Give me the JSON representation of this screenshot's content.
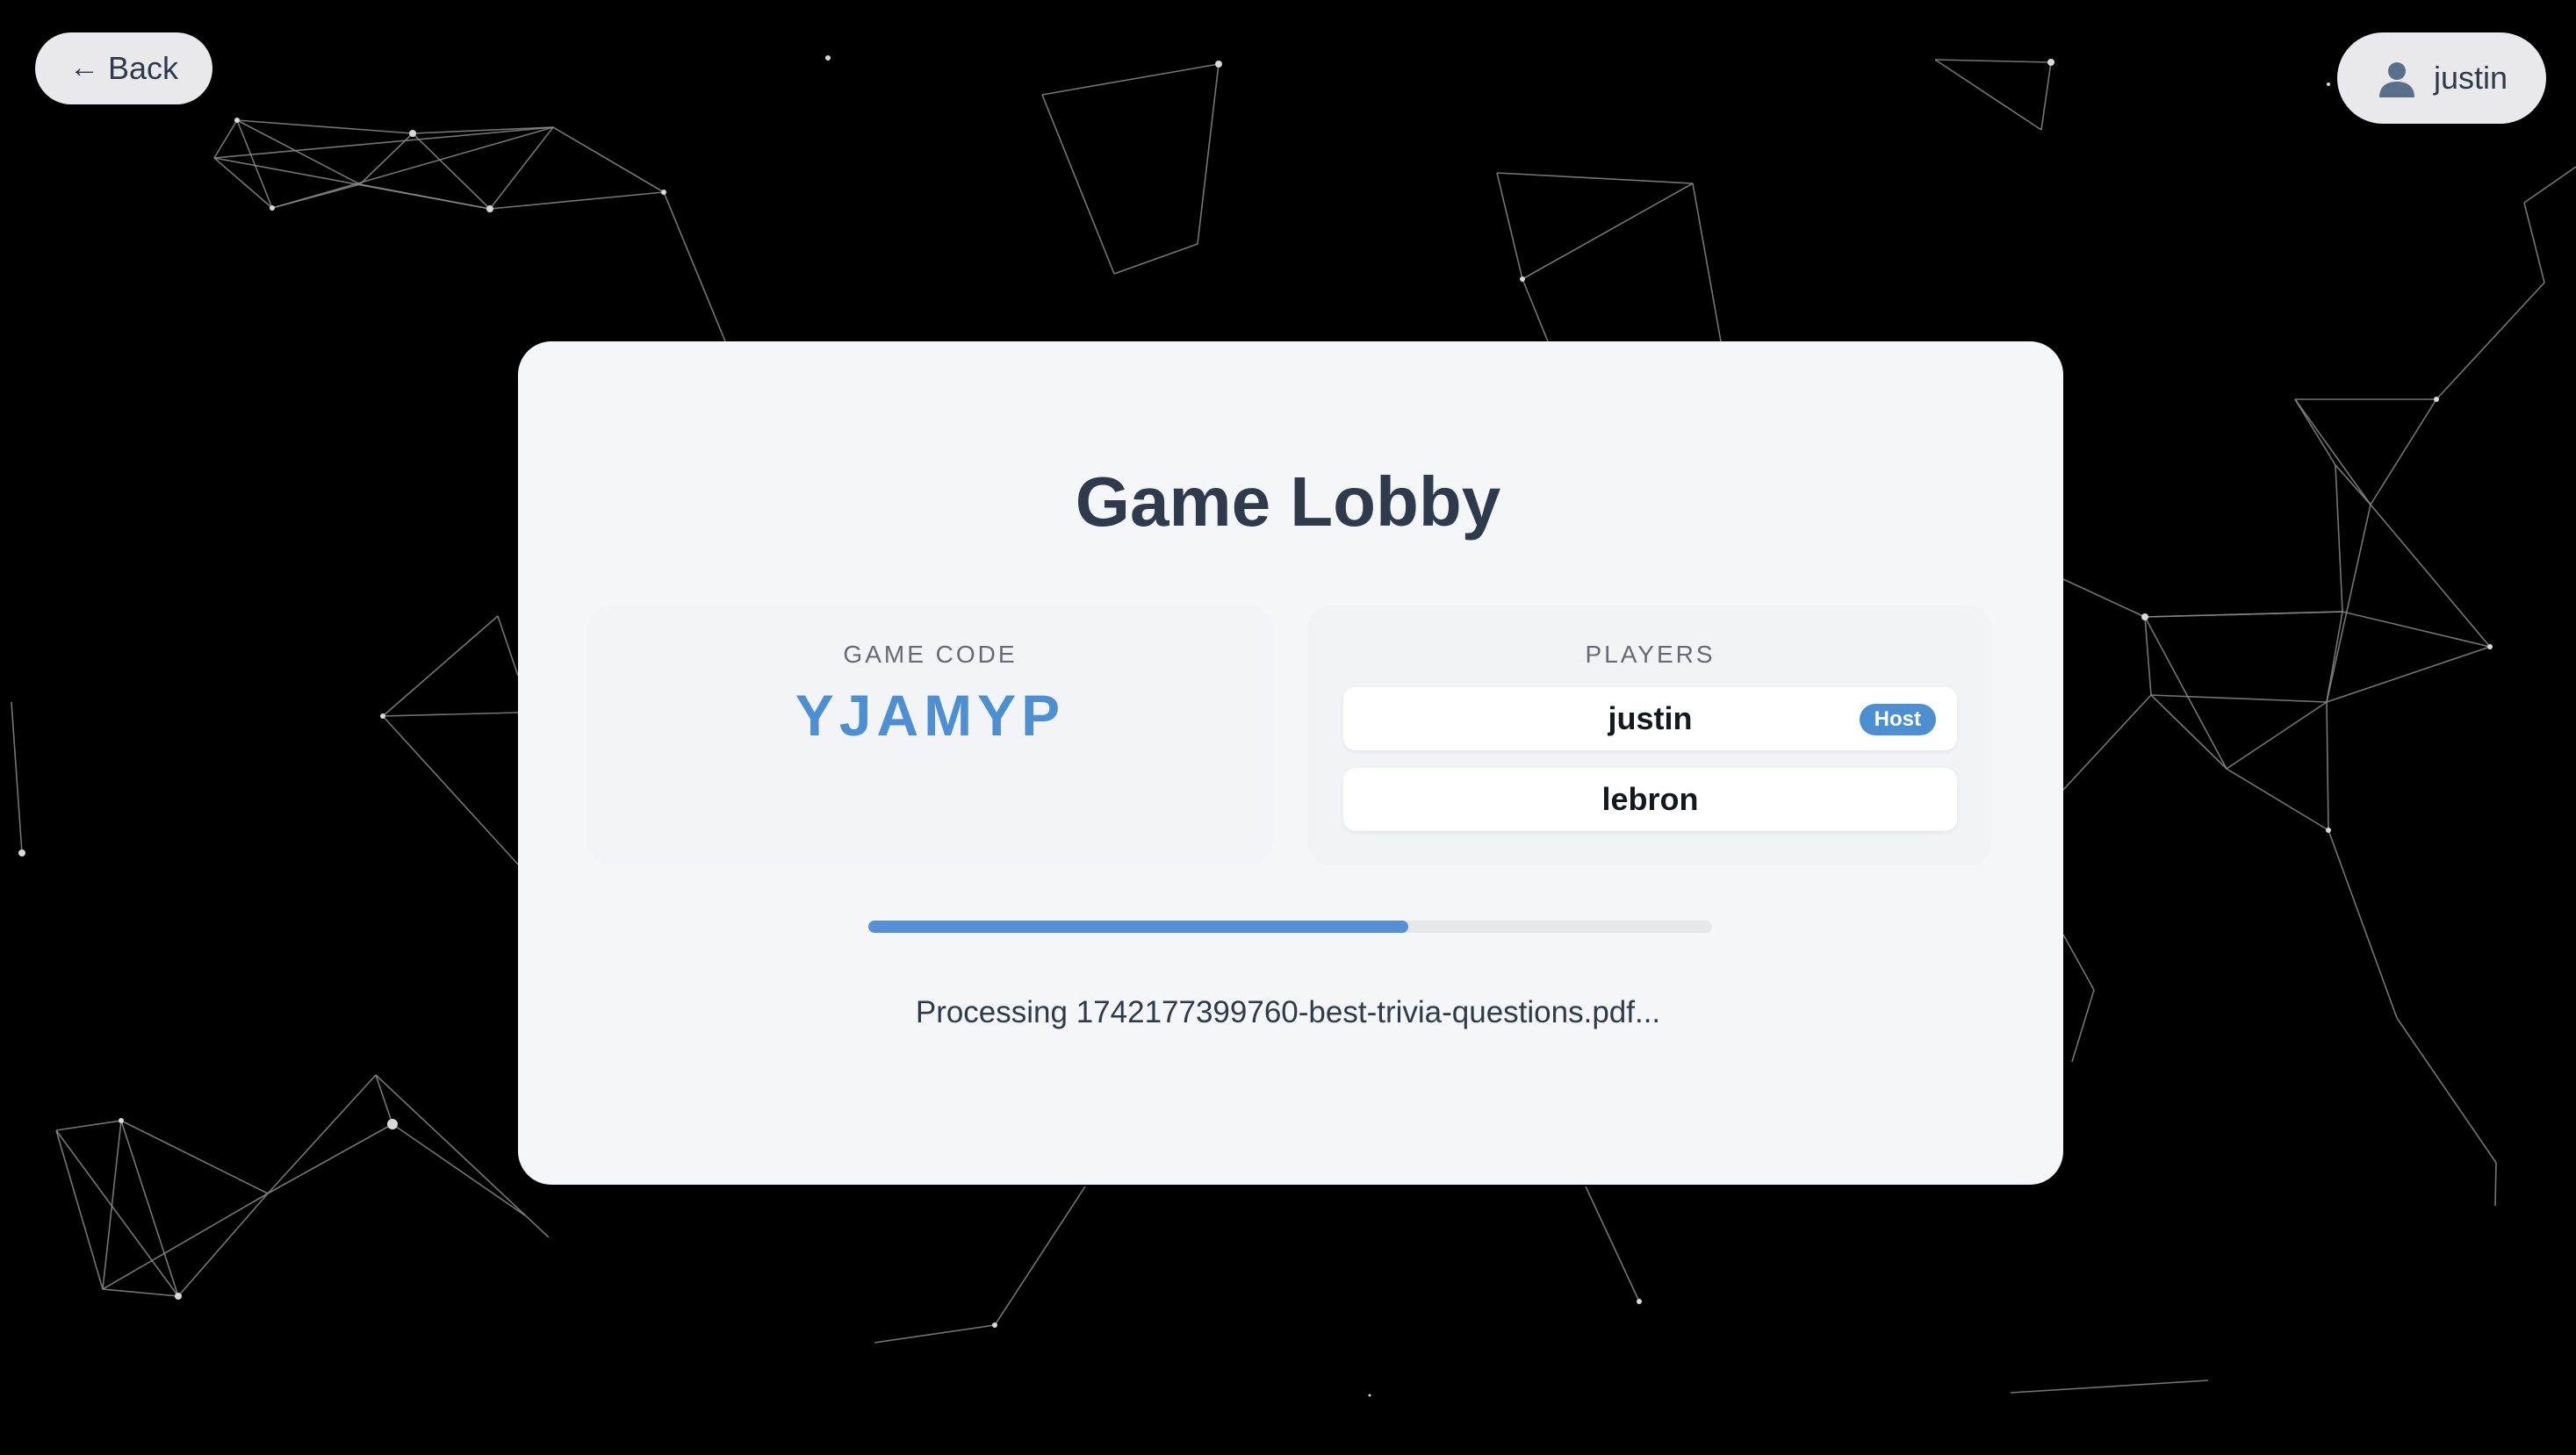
{
  "header": {
    "back_label": "Back",
    "username": "justin"
  },
  "lobby": {
    "title": "Game Lobby",
    "game_code_label": "GAME CODE",
    "game_code": "YJAMYP",
    "players_label": "PLAYERS",
    "players": [
      {
        "name": "justin",
        "badge": "Host"
      },
      {
        "name": "lebron",
        "badge": ""
      }
    ],
    "progress_fraction": 0.64,
    "status_text": "Processing 1742177399760-best-trivia-questions.pdf..."
  },
  "colors": {
    "background": "#000000",
    "card": "#f5f6f7",
    "accent": "#4e8fd1",
    "title_text": "#2f3a4c"
  },
  "icons": {
    "back": "arrow-left-icon",
    "user": "user-avatar-icon"
  }
}
